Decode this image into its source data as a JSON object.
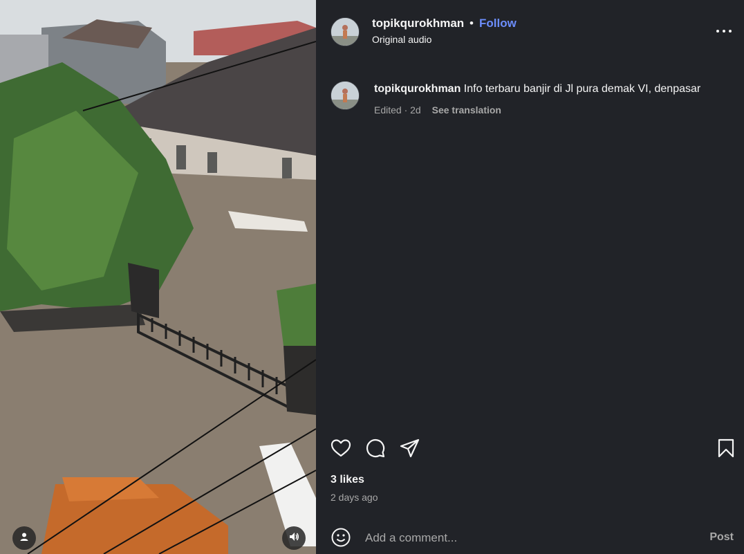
{
  "post": {
    "username": "topikqurokhman",
    "separator": "•",
    "follow_label": "Follow",
    "audio": "Original audio"
  },
  "caption": {
    "username": "topikqurokhman",
    "text": "Info terbaru banjir di Jl pura demak VI, denpasar",
    "edited": "Edited · 2d",
    "see_translation": "See translation"
  },
  "actions": {
    "like_icon": "heart-icon",
    "comment_icon": "comment-icon",
    "share_icon": "share-icon",
    "save_icon": "bookmark-icon"
  },
  "stats": {
    "likes": "3 likes",
    "time_ago": "2 days ago"
  },
  "comment": {
    "placeholder": "Add a comment...",
    "post_label": "Post"
  },
  "media": {
    "user_tag_icon": "user-icon",
    "audio_icon": "speaker-icon"
  },
  "colors": {
    "panel_bg": "#212328",
    "follow": "#6c8dfb",
    "muted": "#a8a8a8"
  }
}
